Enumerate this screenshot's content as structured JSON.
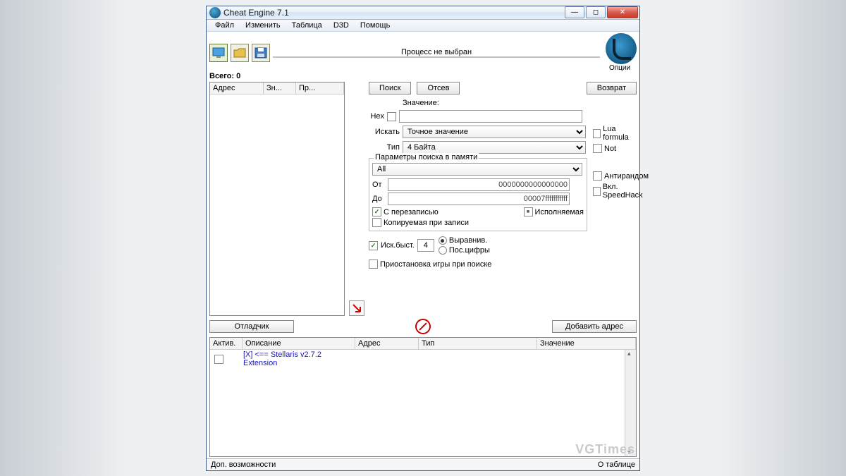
{
  "titlebar": {
    "title": "Cheat Engine 7.1"
  },
  "menu": {
    "file": "Файл",
    "edit": "Изменить",
    "table": "Таблица",
    "d3d": "D3D",
    "help": "Помощь"
  },
  "process": {
    "label": "Процесс не выбран"
  },
  "totals": {
    "label": "Всего:",
    "value": "0"
  },
  "result_headers": {
    "address": "Адрес",
    "val": "Зн...",
    "prev": "Пр..."
  },
  "buttons": {
    "search": "Поиск",
    "filter": "Отсев",
    "back": "Возврат",
    "debugger": "Отладчик",
    "add_address": "Добавить адрес"
  },
  "value": {
    "label": "Значение:",
    "hex": "Hex"
  },
  "scan": {
    "search_label": "Искать",
    "search_type": "Точное значение",
    "type_label": "Тип",
    "value_type": "4 Байта"
  },
  "side_options": {
    "lua": "Lua formula",
    "not": "Not",
    "antirandom": "Антирандом",
    "speedhack": "Вкл. SpeedHack"
  },
  "memory": {
    "group_title": "Параметры поиска в памяти",
    "region": "All",
    "from_label": "От",
    "from_value": "0000000000000000",
    "to_label": "До",
    "to_value": "00007fffffffffff",
    "overwrite": "С перезаписью",
    "executable": "Исполняемая",
    "copy_on_write": "Копируемая при записи"
  },
  "fast": {
    "label": "Иск.быст.",
    "value": "4",
    "alignment": "Выравнив.",
    "last_digits": "Пос.цифры"
  },
  "pause": "Приостановка игры при поиске",
  "options_label": "Опции",
  "cheat_table": {
    "headers": {
      "active": "Актив.",
      "description": "Описание",
      "address": "Адрес",
      "type": "Тип",
      "value": "Значение"
    },
    "rows": [
      {
        "active": false,
        "description": "[X] <== Stellaris v2.7.2 Extension"
      }
    ]
  },
  "statusbar": {
    "left": "Доп. возможности",
    "right": "О таблице"
  },
  "watermark": "VGTimes"
}
